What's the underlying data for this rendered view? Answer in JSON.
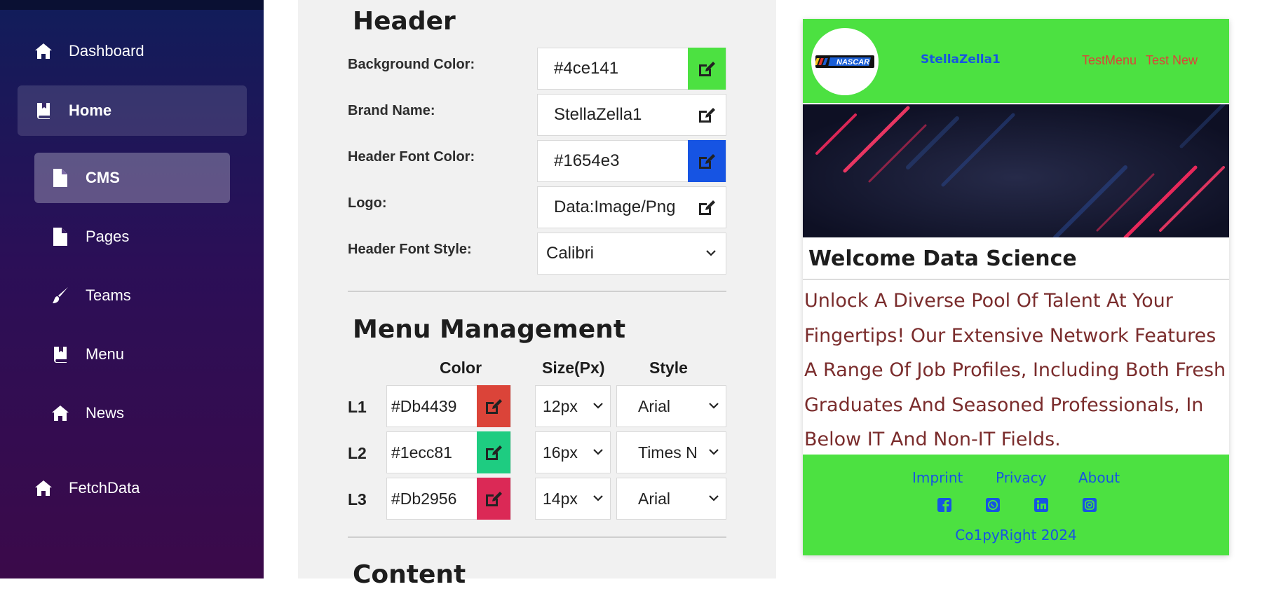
{
  "sidebar": {
    "items": [
      {
        "label": "Dashboard",
        "icon": "home-icon"
      },
      {
        "label": "Home",
        "icon": "book-icon"
      },
      {
        "label": "CMS",
        "icon": "file-icon"
      },
      {
        "label": "Pages",
        "icon": "file-icon"
      },
      {
        "label": "Teams",
        "icon": "brush-icon"
      },
      {
        "label": "Menu",
        "icon": "book-icon"
      },
      {
        "label": "News",
        "icon": "home-icon"
      },
      {
        "label": "FetchData",
        "icon": "home-icon"
      }
    ]
  },
  "header_section": {
    "title": "Header",
    "background_color_label": "Background Color:",
    "background_color_value": "#4ce141",
    "brand_name_label": "Brand Name:",
    "brand_name_value": "StellaZella1",
    "header_font_color_label": "Header Font Color:",
    "header_font_color_value": "#1654e3",
    "logo_label": "Logo:",
    "logo_value": "Data:Image/Png",
    "header_font_style_label": "Header Font Style:",
    "header_font_style_value": "Calibri"
  },
  "menu_management": {
    "title": "Menu Management",
    "columns": [
      "Color",
      "Size(Px)",
      "Style"
    ],
    "rows": [
      {
        "label": "L1",
        "color": "#Db4439",
        "swatch": "#db4439",
        "size": "12px",
        "style": "Arial"
      },
      {
        "label": "L2",
        "color": "#1ecc81",
        "swatch": "#1ecc81",
        "size": "16px",
        "style": "Times N"
      },
      {
        "label": "L3",
        "color": "#Db2956",
        "swatch": "#db2956",
        "size": "14px",
        "style": "Arial"
      }
    ]
  },
  "content_section": {
    "title": "Content"
  },
  "preview": {
    "brand": "StellaZella1",
    "logo_text": "NASCAR",
    "menu": [
      "TestMenu",
      "Test New"
    ],
    "welcome": "Welcome Data Science",
    "body": "Unlock A Diverse Pool Of Talent At Your Fingertips! Our Extensive Network Features A Range Of Job Profiles, Including Both Fresh Graduates And Seasoned Professionals, In Below IT And Non-IT Fields.",
    "footer_links": [
      "Imprint",
      "Privacy",
      "About"
    ],
    "social_icons": [
      "facebook-icon",
      "whatsapp-icon",
      "linkedin-icon",
      "instagram-icon"
    ],
    "copyright": "Co1pyRight 2024",
    "colors": {
      "header_bg": "#4ce141",
      "brand": "#1654e3",
      "menu": "#db4439",
      "body_text": "#7a2c2c"
    }
  }
}
